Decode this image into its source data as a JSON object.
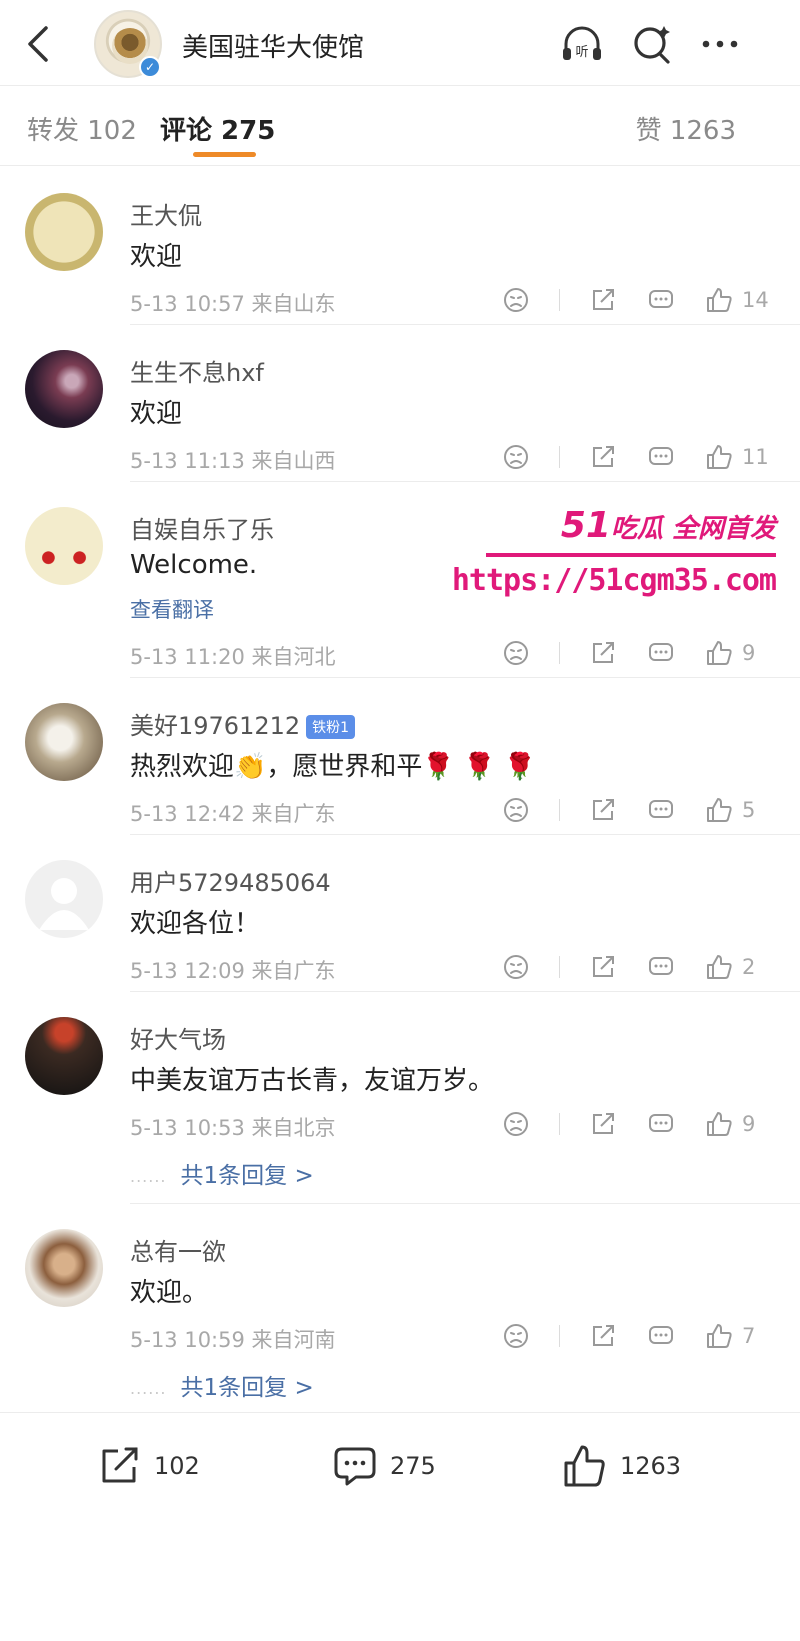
{
  "header": {
    "title": "美国驻华大使馆",
    "icons": [
      "back-icon",
      "listen-icon",
      "search-icon",
      "more-icon"
    ],
    "listen_label": "听"
  },
  "tabs": {
    "repost": "转发 102",
    "comments": "评论 275",
    "likes": "赞 1263",
    "accent_color": "#ee8a28"
  },
  "comments": [
    {
      "name": "王大侃",
      "text": "欢迎",
      "meta": "5-13 10:57 来自山东",
      "likes": "14"
    },
    {
      "name": "生生不息hxf",
      "text": "欢迎",
      "meta": "5-13 11:13 来自山西",
      "likes": "11"
    },
    {
      "name": "自娱自乐了乐",
      "text": "Welcome.",
      "translate": "查看翻译",
      "meta": "5-13 11:20 来自河北",
      "likes": "9"
    },
    {
      "name": "美好19761212",
      "badge": "铁粉1",
      "text": "热烈欢迎👏，愿世界和平🌹 🌹 🌹",
      "meta": "5-13 12:42 来自广东",
      "likes": "5"
    },
    {
      "name": "用户5729485064",
      "text": "欢迎各位！",
      "meta": "5-13 12:09 来自广东",
      "likes": "2"
    },
    {
      "name": "好大气场",
      "text": "中美友谊万古长青，友谊万岁。",
      "meta": "5-13 10:53 来自北京",
      "likes": "9",
      "replies": "共1条回复 >"
    },
    {
      "name": "总有一欲",
      "text": "欢迎。",
      "meta": "5-13 10:59 来自河南",
      "likes": "7",
      "replies": "共1条回复 >"
    }
  ],
  "watermark": {
    "brand": "51",
    "brand_sub": "吃瓜 全网首发",
    "url": "https://51cgm35.com",
    "color": "#e0197a"
  },
  "bottom_bar": {
    "reposts": "102",
    "comments": "275",
    "likes": "1263"
  }
}
